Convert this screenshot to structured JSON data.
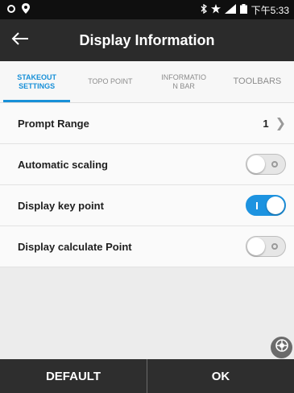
{
  "status_bar": {
    "time": "下午5:33",
    "icons": [
      "settings-icon",
      "location-icon",
      "bluetooth-icon",
      "star-icon",
      "signal-icon",
      "battery-icon"
    ]
  },
  "app_bar": {
    "title": "Display Information",
    "back_icon": "back-arrow-icon"
  },
  "tabs": [
    {
      "line1": "STAKEOUT",
      "line2": "SETTINGS",
      "active": true
    },
    {
      "line1": "TOPO POINT",
      "line2": "",
      "active": false
    },
    {
      "line1": "INFORMATIO",
      "line2": "N BAR",
      "active": false
    },
    {
      "line1": "TOOLBARS",
      "line2": "",
      "active": false
    }
  ],
  "settings": {
    "prompt_range": {
      "label": "Prompt Range",
      "value": "1"
    },
    "automatic_scaling": {
      "label": "Automatic scaling",
      "on": false
    },
    "display_key_point": {
      "label": "Display key point",
      "on": true
    },
    "display_calculate_point": {
      "label": "Display calculate Point",
      "on": false
    }
  },
  "bottom": {
    "default_label": "DEFAULT",
    "ok_label": "OK"
  },
  "colors": {
    "accent": "#1890d8",
    "toolbar": "#2b2b2b",
    "background": "#ececec"
  }
}
